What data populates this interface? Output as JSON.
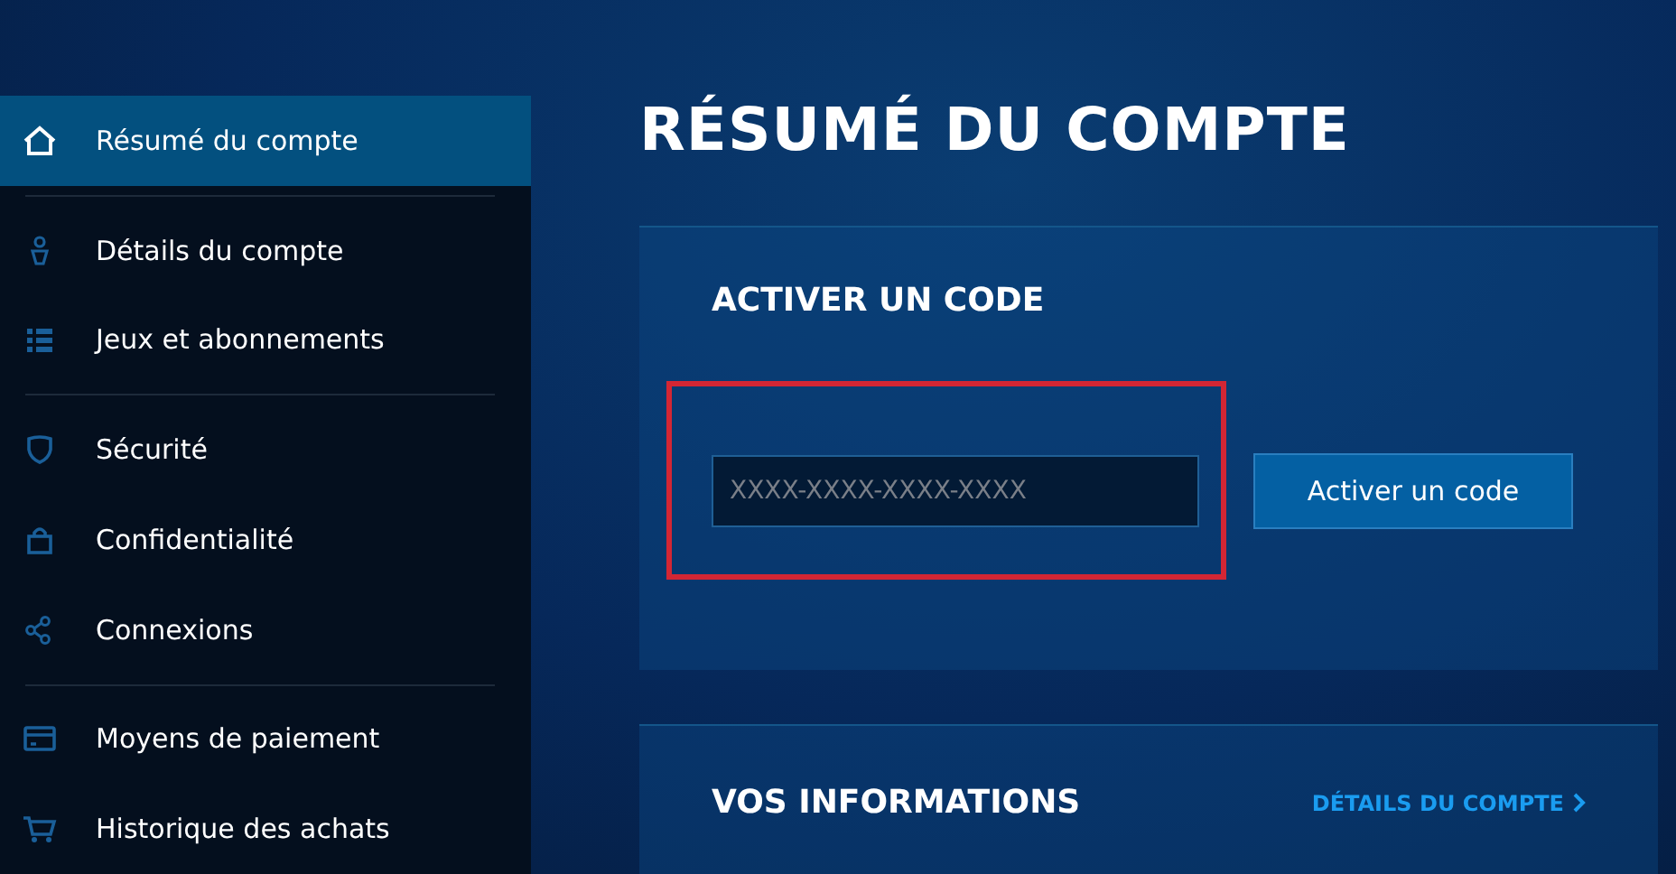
{
  "sidebar": {
    "groups": [
      {
        "items": [
          {
            "label": "Résumé du compte",
            "selected": true
          }
        ]
      },
      {
        "items": [
          {
            "label": "Détails du compte",
            "selected": false
          },
          {
            "label": "Jeux et abonnements",
            "selected": false
          }
        ]
      },
      {
        "items": [
          {
            "label": "Sécurité",
            "selected": false
          },
          {
            "label": "Confidentialité",
            "selected": false
          },
          {
            "label": "Connexions",
            "selected": false
          }
        ]
      },
      {
        "items": [
          {
            "label": "Moyens de paiement",
            "selected": false
          },
          {
            "label": "Historique des achats",
            "selected": false
          }
        ]
      }
    ]
  },
  "page_title": "RÉSUMÉ DU COMPTE",
  "redeem_card": {
    "title": "ACTIVER UN CODE",
    "code_field": {
      "placeholder": "XXXX-XXXX-XXXX-XXXX"
    },
    "button": "Activer un code",
    "highlighted": true
  },
  "info_card": {
    "title": "VOS INFORMATIONS",
    "link": "DÉTAILS DU COMPTE"
  }
}
